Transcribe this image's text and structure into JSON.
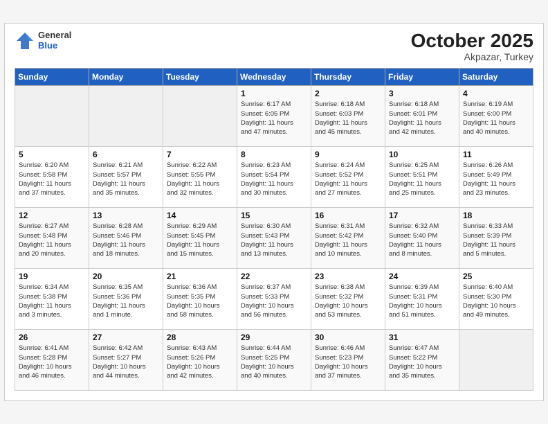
{
  "header": {
    "logo": {
      "general": "General",
      "blue": "Blue"
    },
    "title": "October 2025",
    "location": "Akpazar, Turkey"
  },
  "weekdays": [
    "Sunday",
    "Monday",
    "Tuesday",
    "Wednesday",
    "Thursday",
    "Friday",
    "Saturday"
  ],
  "weeks": [
    [
      {
        "day": "",
        "info": ""
      },
      {
        "day": "",
        "info": ""
      },
      {
        "day": "",
        "info": ""
      },
      {
        "day": "1",
        "info": "Sunrise: 6:17 AM\nSunset: 6:05 PM\nDaylight: 11 hours\nand 47 minutes."
      },
      {
        "day": "2",
        "info": "Sunrise: 6:18 AM\nSunset: 6:03 PM\nDaylight: 11 hours\nand 45 minutes."
      },
      {
        "day": "3",
        "info": "Sunrise: 6:18 AM\nSunset: 6:01 PM\nDaylight: 11 hours\nand 42 minutes."
      },
      {
        "day": "4",
        "info": "Sunrise: 6:19 AM\nSunset: 6:00 PM\nDaylight: 11 hours\nand 40 minutes."
      }
    ],
    [
      {
        "day": "5",
        "info": "Sunrise: 6:20 AM\nSunset: 5:58 PM\nDaylight: 11 hours\nand 37 minutes."
      },
      {
        "day": "6",
        "info": "Sunrise: 6:21 AM\nSunset: 5:57 PM\nDaylight: 11 hours\nand 35 minutes."
      },
      {
        "day": "7",
        "info": "Sunrise: 6:22 AM\nSunset: 5:55 PM\nDaylight: 11 hours\nand 32 minutes."
      },
      {
        "day": "8",
        "info": "Sunrise: 6:23 AM\nSunset: 5:54 PM\nDaylight: 11 hours\nand 30 minutes."
      },
      {
        "day": "9",
        "info": "Sunrise: 6:24 AM\nSunset: 5:52 PM\nDaylight: 11 hours\nand 27 minutes."
      },
      {
        "day": "10",
        "info": "Sunrise: 6:25 AM\nSunset: 5:51 PM\nDaylight: 11 hours\nand 25 minutes."
      },
      {
        "day": "11",
        "info": "Sunrise: 6:26 AM\nSunset: 5:49 PM\nDaylight: 11 hours\nand 23 minutes."
      }
    ],
    [
      {
        "day": "12",
        "info": "Sunrise: 6:27 AM\nSunset: 5:48 PM\nDaylight: 11 hours\nand 20 minutes."
      },
      {
        "day": "13",
        "info": "Sunrise: 6:28 AM\nSunset: 5:46 PM\nDaylight: 11 hours\nand 18 minutes."
      },
      {
        "day": "14",
        "info": "Sunrise: 6:29 AM\nSunset: 5:45 PM\nDaylight: 11 hours\nand 15 minutes."
      },
      {
        "day": "15",
        "info": "Sunrise: 6:30 AM\nSunset: 5:43 PM\nDaylight: 11 hours\nand 13 minutes."
      },
      {
        "day": "16",
        "info": "Sunrise: 6:31 AM\nSunset: 5:42 PM\nDaylight: 11 hours\nand 10 minutes."
      },
      {
        "day": "17",
        "info": "Sunrise: 6:32 AM\nSunset: 5:40 PM\nDaylight: 11 hours\nand 8 minutes."
      },
      {
        "day": "18",
        "info": "Sunrise: 6:33 AM\nSunset: 5:39 PM\nDaylight: 11 hours\nand 5 minutes."
      }
    ],
    [
      {
        "day": "19",
        "info": "Sunrise: 6:34 AM\nSunset: 5:38 PM\nDaylight: 11 hours\nand 3 minutes."
      },
      {
        "day": "20",
        "info": "Sunrise: 6:35 AM\nSunset: 5:36 PM\nDaylight: 11 hours\nand 1 minute."
      },
      {
        "day": "21",
        "info": "Sunrise: 6:36 AM\nSunset: 5:35 PM\nDaylight: 10 hours\nand 58 minutes."
      },
      {
        "day": "22",
        "info": "Sunrise: 6:37 AM\nSunset: 5:33 PM\nDaylight: 10 hours\nand 56 minutes."
      },
      {
        "day": "23",
        "info": "Sunrise: 6:38 AM\nSunset: 5:32 PM\nDaylight: 10 hours\nand 53 minutes."
      },
      {
        "day": "24",
        "info": "Sunrise: 6:39 AM\nSunset: 5:31 PM\nDaylight: 10 hours\nand 51 minutes."
      },
      {
        "day": "25",
        "info": "Sunrise: 6:40 AM\nSunset: 5:30 PM\nDaylight: 10 hours\nand 49 minutes."
      }
    ],
    [
      {
        "day": "26",
        "info": "Sunrise: 6:41 AM\nSunset: 5:28 PM\nDaylight: 10 hours\nand 46 minutes."
      },
      {
        "day": "27",
        "info": "Sunrise: 6:42 AM\nSunset: 5:27 PM\nDaylight: 10 hours\nand 44 minutes."
      },
      {
        "day": "28",
        "info": "Sunrise: 6:43 AM\nSunset: 5:26 PM\nDaylight: 10 hours\nand 42 minutes."
      },
      {
        "day": "29",
        "info": "Sunrise: 6:44 AM\nSunset: 5:25 PM\nDaylight: 10 hours\nand 40 minutes."
      },
      {
        "day": "30",
        "info": "Sunrise: 6:46 AM\nSunset: 5:23 PM\nDaylight: 10 hours\nand 37 minutes."
      },
      {
        "day": "31",
        "info": "Sunrise: 6:47 AM\nSunset: 5:22 PM\nDaylight: 10 hours\nand 35 minutes."
      },
      {
        "day": "",
        "info": ""
      }
    ]
  ]
}
